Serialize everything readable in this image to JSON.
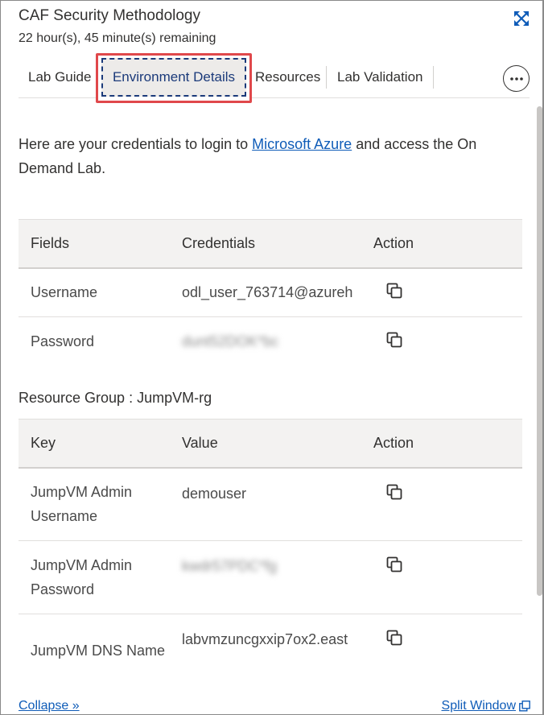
{
  "header": {
    "title": "CAF Security Methodology",
    "remaining": "22 hour(s), 45 minute(s) remaining",
    "expand_icon": "expand-arrows-icon"
  },
  "tabs": [
    {
      "label": "Lab Guide",
      "active": false
    },
    {
      "label": "Environment Details",
      "active": true
    },
    {
      "label": "Resources",
      "active": false
    },
    {
      "label": "Lab Validation",
      "active": false
    }
  ],
  "more_icon": "ellipsis-icon",
  "intro": {
    "before": "Here are your credentials to login to ",
    "link": "Microsoft Azure",
    "after": " and access the On Demand Lab."
  },
  "credentials_table": {
    "headers": [
      "Fields",
      "Credentials",
      "Action"
    ],
    "rows": [
      {
        "field": "Username",
        "value": "odl_user_763714@azureh"
      },
      {
        "field": "Password",
        "value": "dunt52DOK*bc"
      }
    ]
  },
  "resource_group": {
    "title": "Resource Group : JumpVM-rg",
    "headers": [
      "Key",
      "Value",
      "Action"
    ],
    "rows": [
      {
        "key": "JumpVM Admin Username",
        "value": "demouser"
      },
      {
        "key": "JumpVM Admin Password",
        "value": "kwdr57PDC*fg"
      },
      {
        "key": "JumpVM DNS Name",
        "value": "labvmzuncgxxip7ox2.east"
      }
    ]
  },
  "footer": {
    "collapse": "Collapse »",
    "split": "Split Window"
  },
  "colors": {
    "link": "#0f5cb8",
    "highlight_border": "#e0484b",
    "active_tab_bg": "#edebe9"
  }
}
